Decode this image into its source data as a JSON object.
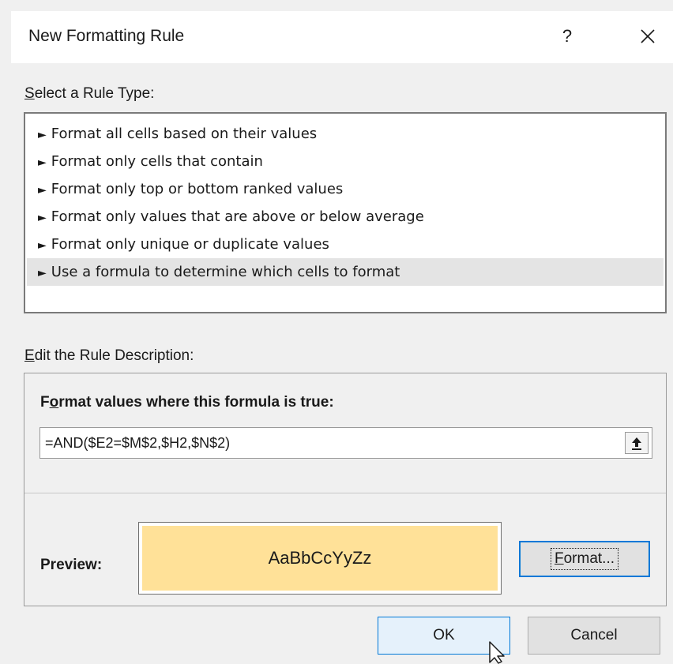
{
  "dialog": {
    "title": "New Formatting Rule",
    "help_label": "?",
    "close_icon": "close-icon"
  },
  "rule_type": {
    "label_accel": "S",
    "label_rest": "elect a Rule Type:",
    "items": [
      {
        "label": "Format all cells based on their values",
        "selected": false
      },
      {
        "label": "Format only cells that contain",
        "selected": false
      },
      {
        "label": "Format only top or bottom ranked values",
        "selected": false
      },
      {
        "label": "Format only values that are above or below average",
        "selected": false
      },
      {
        "label": "Format only unique or duplicate values",
        "selected": false
      },
      {
        "label": "Use a formula to determine which cells to format",
        "selected": true
      }
    ],
    "item_arrow": "►"
  },
  "description": {
    "label_accel": "E",
    "label_rest": "dit the Rule Description:",
    "formula_label_pre": "F",
    "formula_label_accel": "o",
    "formula_label_rest": "rmat values where this formula is true:",
    "formula_value": "=AND($E2=$M$2,$H2,$N$2)",
    "collapse_icon": "collapse-dialog-icon"
  },
  "preview": {
    "label": "Preview:",
    "sample_text": "AaBbCcYyZz",
    "fill_color": "#FFE198"
  },
  "buttons": {
    "format_accel": "F",
    "format_rest": "ormat...",
    "ok": "OK",
    "cancel": "Cancel"
  },
  "colors": {
    "accent": "#0078D7",
    "selected_row": "#E4E4E4"
  }
}
